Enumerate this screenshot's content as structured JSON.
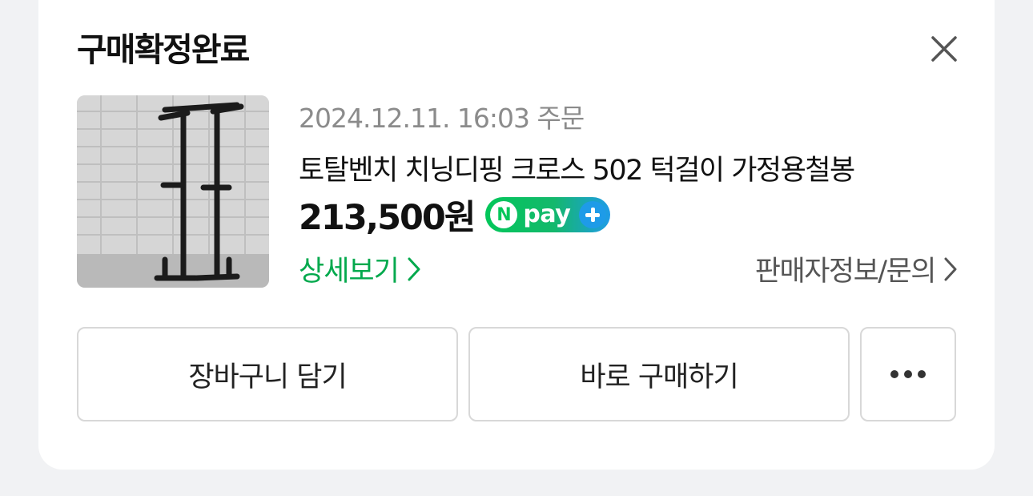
{
  "card": {
    "title": "구매확정완료"
  },
  "order": {
    "date": "2024.12.11. 16:03 주문",
    "product_name": "토탈벤치 치닝디핑 크로스 502 턱걸이 가정용철봉",
    "price": "213,500원",
    "npay_badge": {
      "n": "N",
      "text": "pay",
      "colors": {
        "start": "#03c75a",
        "end": "#1e9be8"
      }
    },
    "detail_link": "상세보기",
    "seller_link": "판매자정보/문의"
  },
  "buttons": {
    "cart": "장바구니 담기",
    "buy": "바로 구매하기",
    "more_icon": "more-dots-icon"
  },
  "colors": {
    "accent_green": "#03a94d",
    "muted_text": "#8b8b8b",
    "border": "#d8d8d8"
  }
}
